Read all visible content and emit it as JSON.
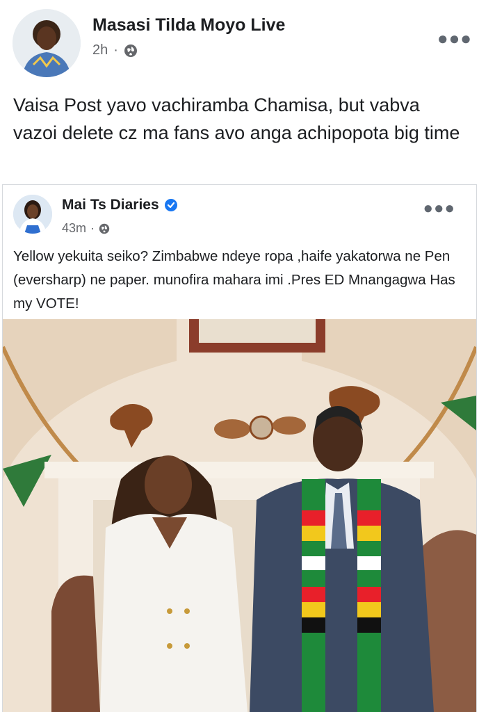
{
  "post": {
    "author": "Masasi Tilda Moyo Live",
    "time": "2h",
    "separator": "·",
    "privacy_icon": "globe-icon",
    "more_icon": "more-horizontal-icon",
    "text": "Vaisa Post yavo vachiramba Chamisa, but vabva vazoi delete cz ma fans avo anga achipopota big time"
  },
  "shared_post": {
    "author": "Mai Ts Diaries",
    "verified_icon": "verified-badge-icon",
    "time": "43m",
    "separator": "·",
    "privacy_icon": "globe-icon",
    "more_icon": "more-horizontal-icon",
    "text": "Yellow yekuita seiko? Zimbabwe ndeye ropa ,haife yakatorwa ne Pen (eversharp) ne paper. munofira mahara imi .Pres ED Mnangagwa Has my VOTE!",
    "photo": "photo of a woman in a white blazer and a man in a dark suit with a Zimbabwe flag scarf in a room with a fireplace"
  },
  "colors": {
    "text": "#1c1e21",
    "meta": "#65676b",
    "link_blue": "#1877f2"
  }
}
